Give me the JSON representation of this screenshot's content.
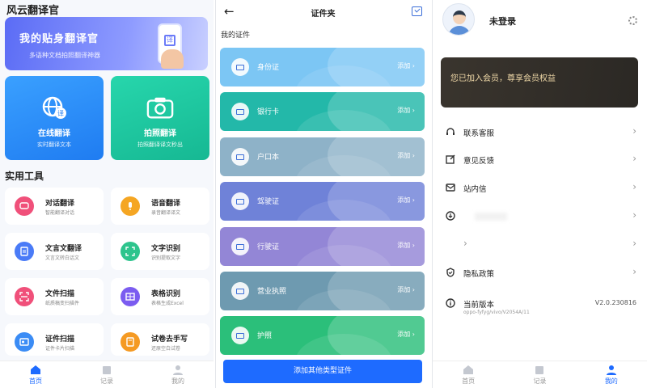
{
  "home": {
    "app_title": "风云翻译官",
    "banner": {
      "title": "我的贴身翻译官",
      "subtitle": "多语种文档拍照翻译神器",
      "icon_char": "译"
    },
    "big_cards": [
      {
        "title": "在线翻译",
        "subtitle": "实时翻译文本",
        "icon": "globe-icon"
      },
      {
        "title": "拍照翻译",
        "subtitle": "拍照翻译译文秒出",
        "icon": "camera-icon"
      }
    ],
    "section_title": "实用工具",
    "tools": [
      {
        "title": "对话翻译",
        "subtitle": "智能翻译对话",
        "color": "#f0507a"
      },
      {
        "title": "语音翻译",
        "subtitle": "录音翻译译文",
        "color": "#f5a623"
      },
      {
        "title": "文言文翻译",
        "subtitle": "文言文转白话文",
        "color": "#4a7bf7"
      },
      {
        "title": "文字识别",
        "subtitle": "识别提取文字",
        "color": "#2ec48d"
      },
      {
        "title": "文件扫描",
        "subtitle": "纸质稿变扫描件",
        "color": "#f0507a"
      },
      {
        "title": "表格识别",
        "subtitle": "表格生成Excel",
        "color": "#7b5cf0"
      },
      {
        "title": "证件扫描",
        "subtitle": "证件卡片扫描",
        "color": "#3b8cf5"
      },
      {
        "title": "试卷去手写",
        "subtitle": "还原空白试卷",
        "color": "#f59a23"
      }
    ],
    "tabs": [
      "首页",
      "记录",
      "我的"
    ]
  },
  "wallet": {
    "title": "证件夹",
    "section": "我的证件",
    "docs": [
      {
        "name": "身份证",
        "action": "添加",
        "color": "#7cc6f4"
      },
      {
        "name": "银行卡",
        "action": "添加",
        "color": "#23b8a9"
      },
      {
        "name": "户口本",
        "action": "添加",
        "color": "#8eb2c8"
      },
      {
        "name": "驾驶证",
        "action": "添加",
        "color": "#6f82d8"
      },
      {
        "name": "行驶证",
        "action": "添加",
        "color": "#9386d6"
      },
      {
        "name": "营业执照",
        "action": "添加",
        "color": "#6e9ab0"
      },
      {
        "name": "护照",
        "action": "添加",
        "color": "#2bbf7a"
      }
    ],
    "add_button": "添加其他类型证件"
  },
  "profile": {
    "username": "未登录",
    "vip_text": "您已加入会员，尊享会员权益",
    "menu": [
      {
        "label": "联系客服",
        "icon": "headset-icon"
      },
      {
        "label": "意见反馈",
        "icon": "edit-icon"
      },
      {
        "label": "站内信",
        "icon": "mail-icon"
      },
      {
        "label": "隐私政策",
        "icon": "shield-icon"
      }
    ],
    "version_label": "当前版本",
    "version_sub": "oppo-fyfyg/vivo/V2054A/11",
    "version_value": "V2.0.230816",
    "tabs": [
      "首页",
      "记录",
      "我的"
    ]
  }
}
